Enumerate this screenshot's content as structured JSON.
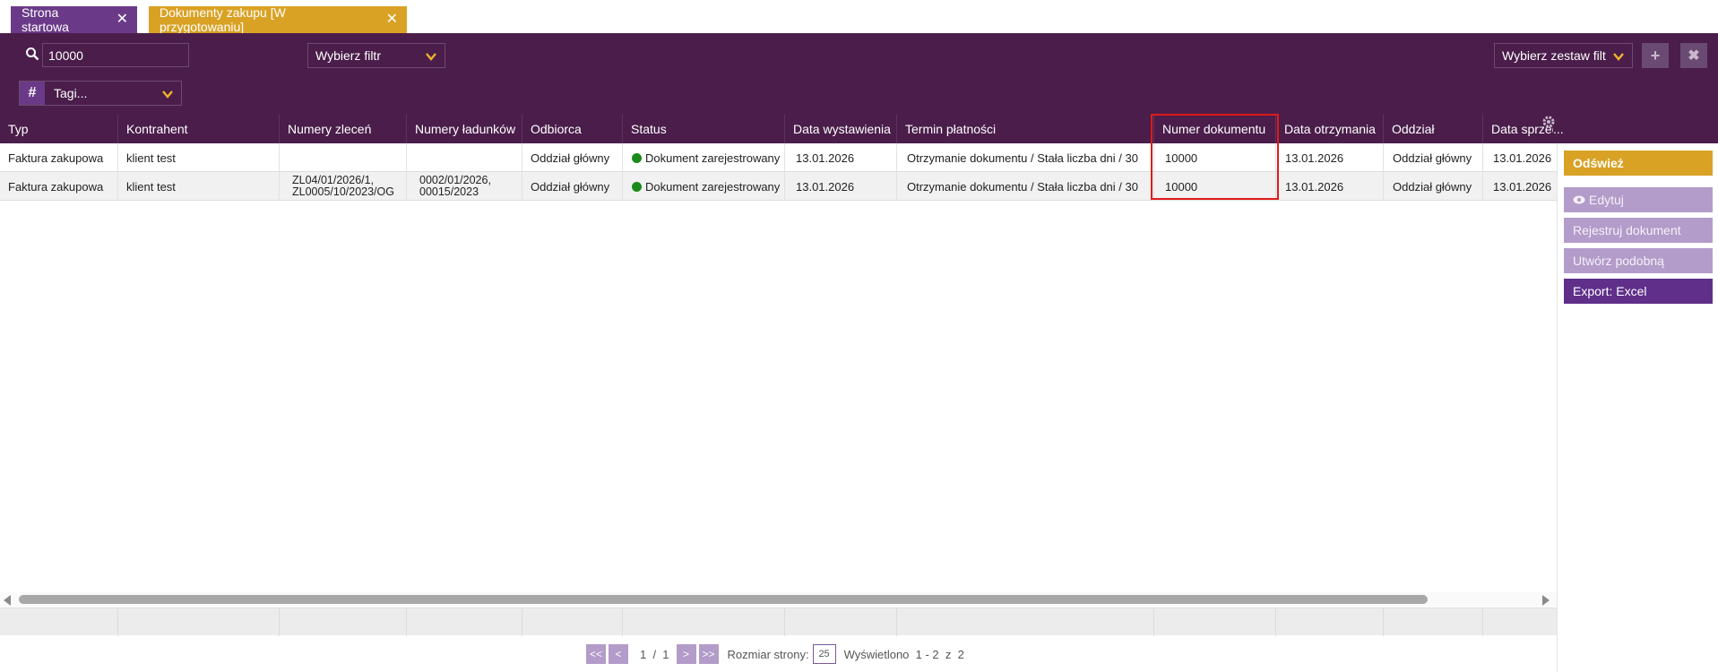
{
  "tabs": [
    {
      "label": "Strona startowa",
      "close": "✕"
    },
    {
      "label": "Dokumenty zakupu [W przygotowaniu]",
      "close": "✕"
    }
  ],
  "toolbar": {
    "search_value": "10000",
    "filter_label": "Wybierz filtr",
    "filterset_label": "Wybierz zestaw filt",
    "tags_hash": "#",
    "tags_label": "Tagi...",
    "plus": "+",
    "close": "✖"
  },
  "table": {
    "columns": [
      "Typ",
      "Kontrahent",
      "Numery zleceń",
      "Numery ładunków",
      "Odbiorca",
      "Status",
      "Data wystawienia",
      "Termin płatności",
      "Numer dokumentu",
      "Data otrzymania",
      "Oddział",
      "Data sprzedaży"
    ],
    "more": "...",
    "rows": [
      {
        "typ": "Faktura zakupowa",
        "kontrahent": "klient test",
        "zlecenia": "",
        "ladunki": "",
        "odbiorca": "Oddział główny",
        "status": "Dokument zarejestrowany",
        "data_wystawienia": "13.01.2026",
        "termin": "Otrzymanie dokumentu / Stała liczba dni / 30",
        "numer": "10000",
        "data_otrzymania": "13.01.2026",
        "oddzial": "Oddział główny",
        "data_sprzedazy": "13.01.2026"
      },
      {
        "typ": "Faktura zakupowa",
        "kontrahent": "klient test",
        "zlecenia": "ZL04/01/2026/1, ZL0005/10/2023/OG",
        "ladunki": "0002/01/2026, 00015/2023",
        "odbiorca": "Oddział główny",
        "status": "Dokument zarejestrowany",
        "data_wystawienia": "13.01.2026",
        "termin": "Otrzymanie dokumentu / Stała liczba dni / 30",
        "numer": "10000",
        "data_otrzymania": "13.01.2026",
        "oddzial": "Oddział główny",
        "data_sprzedazy": "13.01.2026"
      }
    ],
    "status_color": "#1a8a1a"
  },
  "side_buttons": {
    "refresh": "Odśwież",
    "edit": "Edytuj",
    "register": "Rejestruj dokument",
    "similar": "Utwórz podobną",
    "export": "Export: Excel"
  },
  "pager": {
    "first": "<<",
    "prev": "<",
    "page_text": "1  /  1",
    "next": ">",
    "last": ">>",
    "size_label": "Rozmiar strony:",
    "size_value": "25",
    "shown_text": "Wyświetlono  1 - 2  z  2"
  },
  "colors": {
    "header_purple": "#4a1d4a",
    "accent_gold": "#d9a225",
    "light_purple": "#b39cc9",
    "dark_purple": "#5f2f8a",
    "highlight_red": "#e01a1a"
  }
}
